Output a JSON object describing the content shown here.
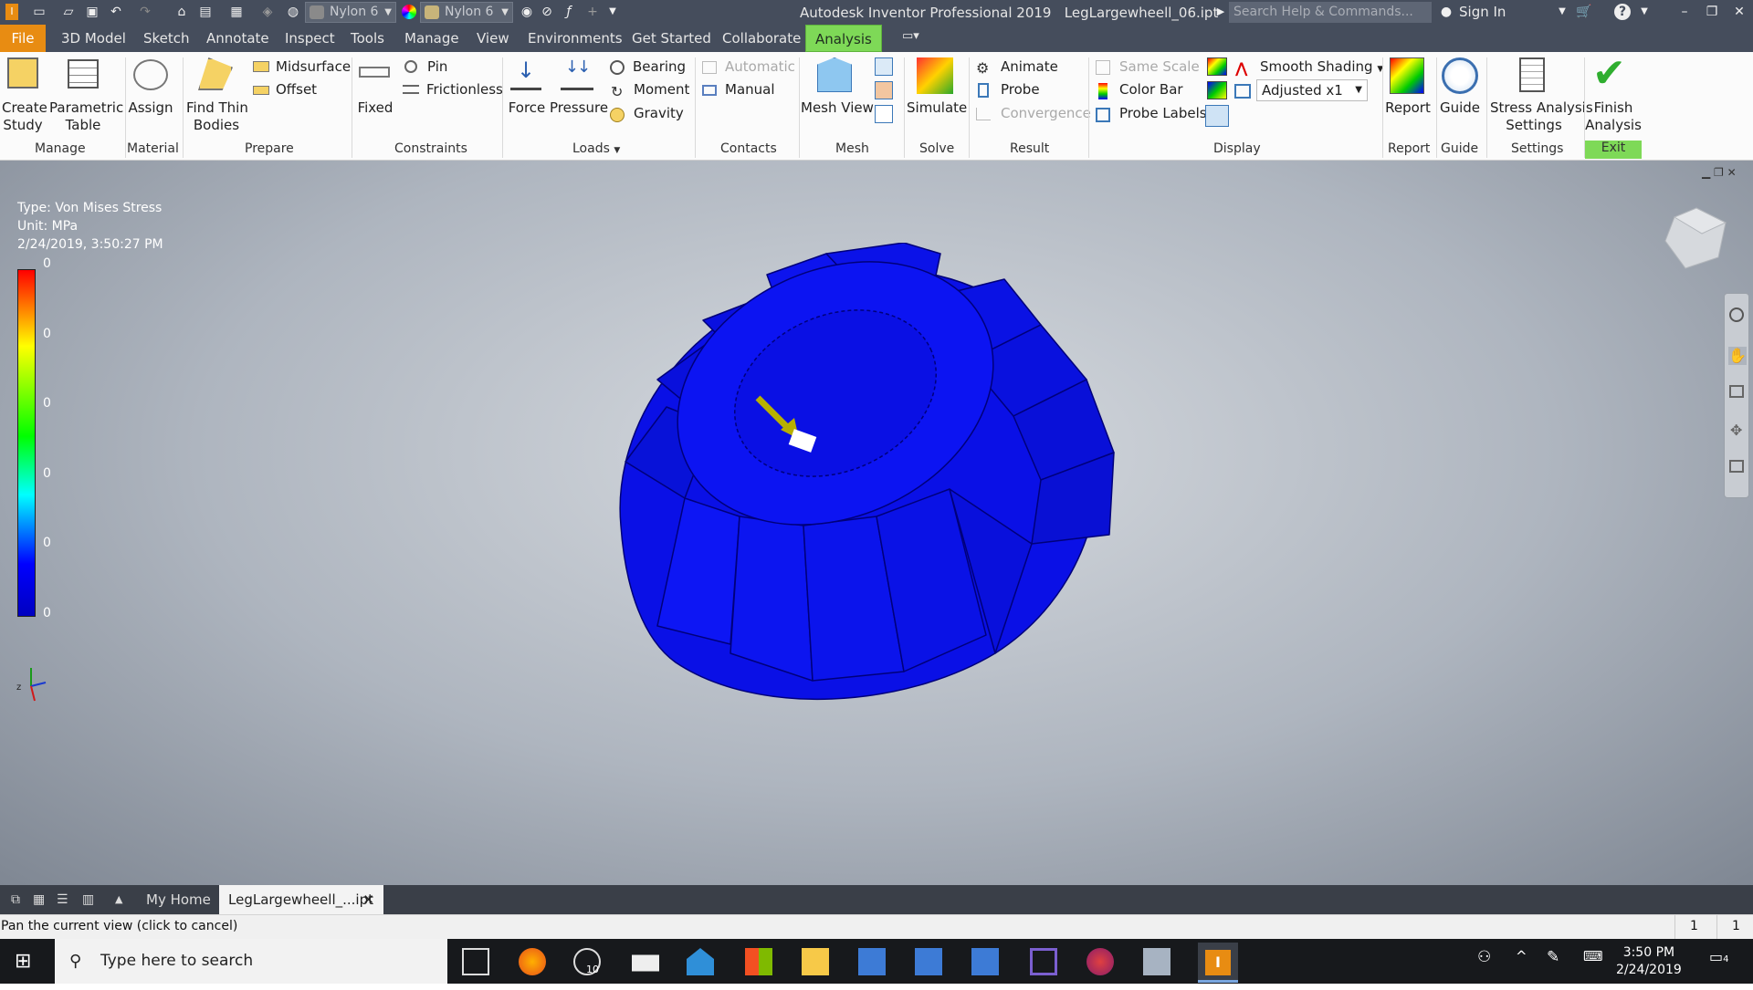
{
  "titlebar": {
    "material_1": "Nylon 6",
    "material_2": "Nylon 6",
    "app_title": "Autodesk Inventor Professional 2019",
    "file_name": "LegLargewheell_06.ipt",
    "search_placeholder": "Search Help & Commands...",
    "sign_in": "Sign In"
  },
  "menu": {
    "file": "File",
    "tabs": [
      "3D Model",
      "Sketch",
      "Annotate",
      "Inspect",
      "Tools",
      "Manage",
      "View",
      "Environments",
      "Get Started",
      "Collaborate"
    ],
    "active": "Analysis"
  },
  "ribbon": {
    "manage": {
      "create_study": [
        "Create",
        "Study"
      ],
      "parametric_table": [
        "Parametric",
        "Table"
      ],
      "label": "Manage"
    },
    "material": {
      "assign": "Assign",
      "label": "Material"
    },
    "prepare": {
      "find_thin": [
        "Find Thin",
        "Bodies"
      ],
      "midsurface": "Midsurface",
      "offset": "Offset",
      "label": "Prepare"
    },
    "constraints": {
      "fixed": "Fixed",
      "pin": "Pin",
      "frictionless": "Frictionless",
      "label": "Constraints"
    },
    "loads": {
      "force": "Force",
      "pressure": "Pressure",
      "bearing": "Bearing",
      "moment": "Moment",
      "gravity": "Gravity",
      "label": "Loads"
    },
    "contacts": {
      "automatic": "Automatic",
      "manual": "Manual",
      "label": "Contacts"
    },
    "mesh": {
      "mesh_view": "Mesh View",
      "label": "Mesh"
    },
    "solve": {
      "simulate": "Simulate",
      "label": "Solve"
    },
    "result": {
      "animate": "Animate",
      "probe": "Probe",
      "convergence": "Convergence",
      "label": "Result"
    },
    "display": {
      "same_scale": "Same Scale",
      "color_bar": "Color Bar",
      "probe_labels": "Probe Labels",
      "smooth_shading": "Smooth Shading",
      "adjusted": "Adjusted x1",
      "label": "Display"
    },
    "report": {
      "report": "Report",
      "label": "Report"
    },
    "guide": {
      "guide": "Guide",
      "label": "Guide"
    },
    "settings": {
      "stress_settings": [
        "Stress Analysis",
        "Settings"
      ],
      "label": "Settings"
    },
    "exit": {
      "finish": [
        "Finish",
        "Analysis"
      ],
      "label": "Exit"
    }
  },
  "legend": {
    "type": "Type: Von Mises Stress",
    "unit": "Unit: MPa",
    "timestamp": "2/24/2019, 3:50:27 PM",
    "ticks": [
      "0",
      "0",
      "0",
      "0",
      "0",
      "0"
    ]
  },
  "doctabs": {
    "home": "My Home",
    "file": "LegLargewheell_...ipt"
  },
  "status": {
    "message": "Pan the current view (click to cancel)",
    "count1": "1",
    "count2": "1"
  },
  "taskbar": {
    "search": "Type here to search",
    "time": "3:50 PM",
    "date": "2/24/2019",
    "notifications": "4",
    "badge": "10"
  },
  "colors": {
    "accent_orange": "#e88c12",
    "analysis_green": "#7ed957",
    "model_blue": "#0a10e6"
  }
}
